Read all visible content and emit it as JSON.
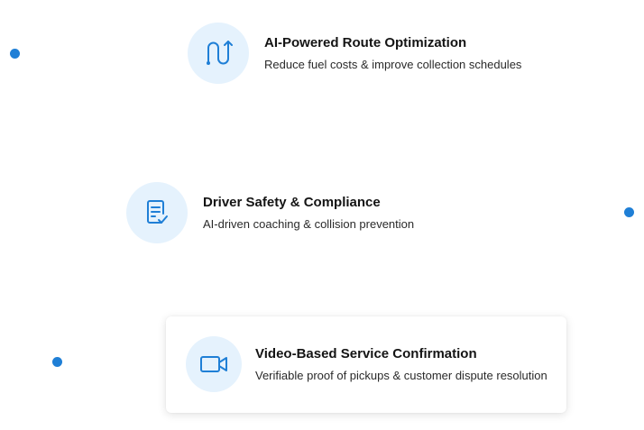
{
  "colors": {
    "accent": "#1f7fd6",
    "icon_bg": "#e5f2fd"
  },
  "features": [
    {
      "icon": "route-icon",
      "title": "AI-Powered Route Optimization",
      "description": "Reduce fuel costs & improve collection schedules"
    },
    {
      "icon": "checklist-icon",
      "title": "Driver Safety & Compliance",
      "description": "AI-driven coaching & collision prevention"
    },
    {
      "icon": "video-camera-icon",
      "title": "Video-Based Service Confirmation",
      "description": "Verifiable proof of pickups & customer dispute resolution"
    }
  ]
}
